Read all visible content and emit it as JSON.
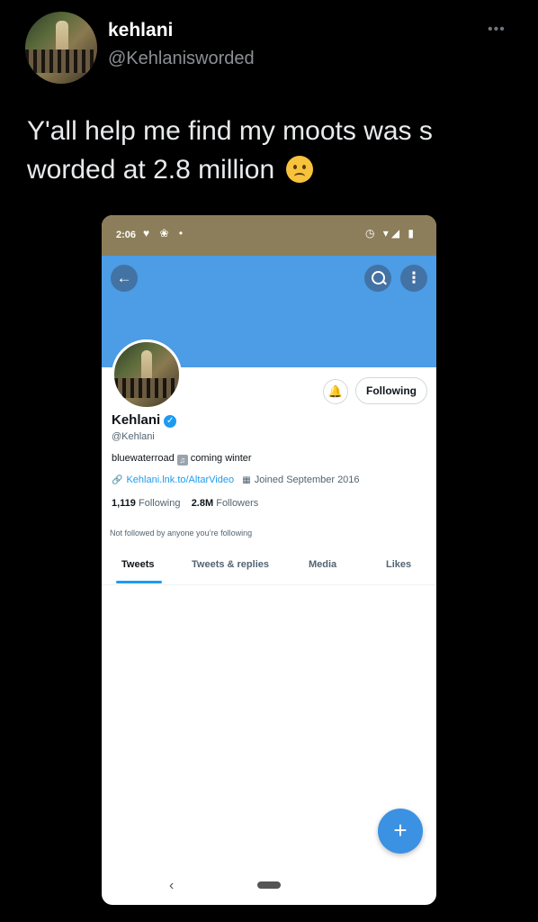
{
  "tweet": {
    "author_name": "kehlani",
    "author_handle": "@Kehlanisworded",
    "more_label": "•••",
    "text": "Y'all help me find my moots was s worded at 2.8 million"
  },
  "phone": {
    "status_time": "2:06",
    "status_left_icons": "♥ ❀ •",
    "status_right_icons": "◷ ▾◢ ▮",
    "banner_color": "#4c9ce6",
    "back_icon": "←",
    "more_icon": "⋮",
    "notify_icon": "🔔",
    "following_label": "Following",
    "name": "Kehlani",
    "verified_icon": "✓",
    "handle": "@Kehlani",
    "bio_before": "bluewaterroad",
    "bio_after": "coming winter",
    "link_icon": "🔗",
    "link": "Kehlani.lnk.to/AltarVideo",
    "calendar_icon": "▦",
    "joined": "Joined September 2016",
    "following_count": "1,119",
    "following_text": "Following",
    "followers_count": "2.8M",
    "followers_text": "Followers",
    "not_followed": "Not followed by anyone you’re following",
    "tabs": [
      "Tweets",
      "Tweets & replies",
      "Media",
      "Likes"
    ],
    "fab_icon": "+",
    "nav_back_icon": "‹"
  }
}
